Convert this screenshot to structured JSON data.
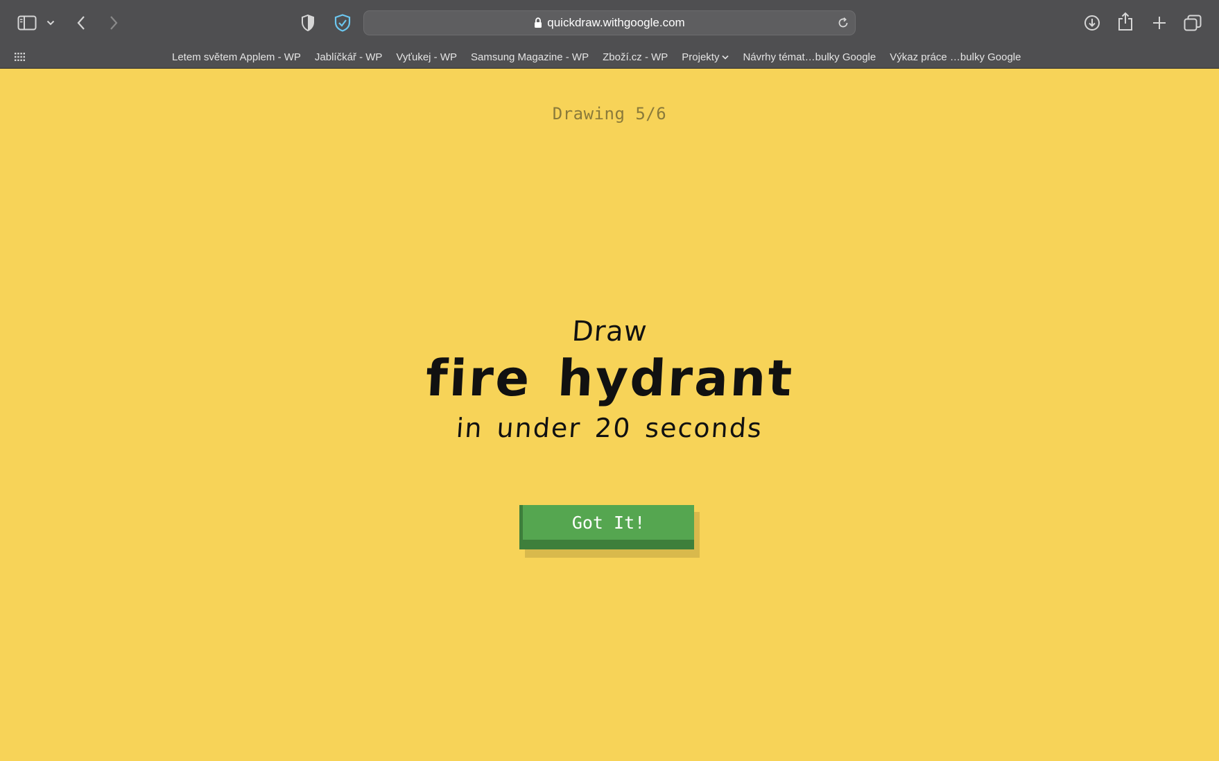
{
  "browser": {
    "url": "quickdraw.withgoogle.com",
    "bookmarks": [
      {
        "label": "Letem světem Applem - WP"
      },
      {
        "label": "Jablíčkář - WP"
      },
      {
        "label": "Vyťukej - WP"
      },
      {
        "label": "Samsung Magazine - WP"
      },
      {
        "label": "Zboží.cz - WP"
      },
      {
        "label": "Projekty"
      },
      {
        "label": "Návrhy témat…bulky Google"
      },
      {
        "label": "Výkaz práce …bulky Google"
      }
    ],
    "icons": {
      "sidebar": "sidebar-icon",
      "back": "chevron-left-icon",
      "forward": "chevron-right-icon",
      "privacy": "shield-half-icon",
      "extension": "shield-check-icon",
      "downloads": "download-icon",
      "share": "share-icon",
      "new_tab": "plus-icon",
      "tabs": "tab-overview-icon"
    }
  },
  "game": {
    "progress": "Drawing 5/6",
    "prompt_intro": "Draw",
    "prompt_word": "fire hydrant",
    "prompt_time": "in under 20 seconds",
    "button_label": "Got It!"
  },
  "colors": {
    "background": "#f7d358",
    "button": "#55a650",
    "button_edge": "#3e7f3b",
    "chrome": "#4f4f51"
  }
}
